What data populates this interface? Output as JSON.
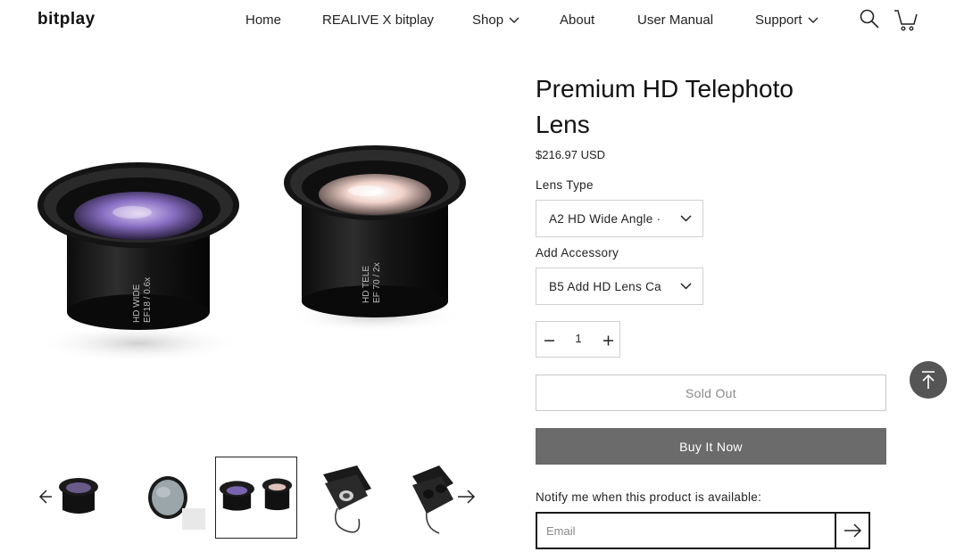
{
  "header": {
    "logo": "bitplay",
    "nav": [
      {
        "label": "Home"
      },
      {
        "label": "REALIVE X bitplay"
      },
      {
        "label": "Shop"
      },
      {
        "label": "About"
      },
      {
        "label": "User Manual"
      },
      {
        "label": "Support"
      }
    ],
    "icons": [
      "search-icon",
      "cart-icon"
    ]
  },
  "gallery": {
    "thumbnail_count": 5,
    "active_thumbnail": 3,
    "main_image_lens_labels": [
      {
        "line1": "HD WIDE",
        "line2": "EF18 / 0.6x"
      },
      {
        "line1": "HD TELE",
        "line2": "EF 70 / 2x"
      }
    ]
  },
  "product": {
    "title": "Premium HD Telephoto Lens",
    "price": "$216.97 USD",
    "lens_type_label": "Lens Type",
    "lens_type_value": "A2 HD Wide Angle ·",
    "accessory_label": "Add Accessory",
    "accessory_value": "B5 Add HD Lens Ca",
    "quantity": "1",
    "sold_out_label": "Sold Out",
    "buy_now_label": "Buy It Now",
    "notify_label": "Notify me when this product is available:",
    "email_placeholder": "Email"
  },
  "colors": {
    "buy_button": "#6b6b6b",
    "back_to_top": "#555555",
    "lens_wide_glass": "#8a6fc4",
    "lens_tele_glass": "#e8b8b0"
  }
}
